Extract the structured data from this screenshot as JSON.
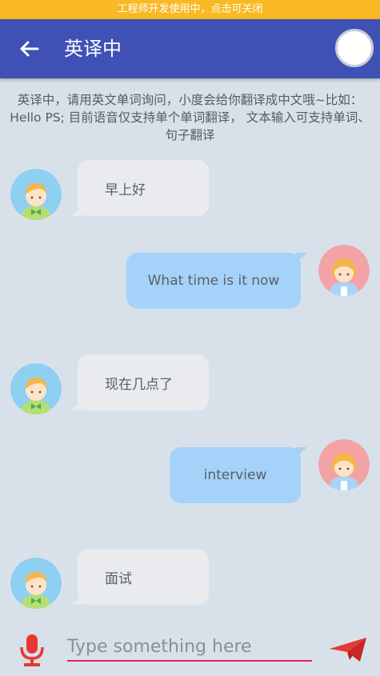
{
  "dev_banner": {
    "text": "工程师开发使用中，点击可关闭"
  },
  "appbar": {
    "title": "英译中",
    "back_icon": "arrow-left-icon",
    "avatar_icon": "profile-circle-icon",
    "color": "#3f51b5"
  },
  "intro": {
    "text": "英译中，请用英文单词询问，小度会给你翻译成中文哦~比如：Hello PS; 目前语音仅支持单个单词翻译，  文本输入可支持单词、句子翻译"
  },
  "messages": [
    {
      "side": "left",
      "text": "早上好",
      "avatar": "boy-avatar-icon"
    },
    {
      "side": "right",
      "text": "What time is it now",
      "avatar": "girl-avatar-icon"
    },
    {
      "side": "left",
      "text": "现在几点了",
      "avatar": "boy-avatar-icon"
    },
    {
      "side": "right",
      "text": "interview",
      "avatar": "girl-avatar-icon"
    },
    {
      "side": "left",
      "text": "面试",
      "avatar": "boy-avatar-icon"
    }
  ],
  "input_bar": {
    "placeholder": "Type something here",
    "value": "",
    "mic_icon": "microphone-icon",
    "send_icon": "paper-plane-send-icon",
    "accent": "#e91e63",
    "icon_color": "#e53935"
  }
}
